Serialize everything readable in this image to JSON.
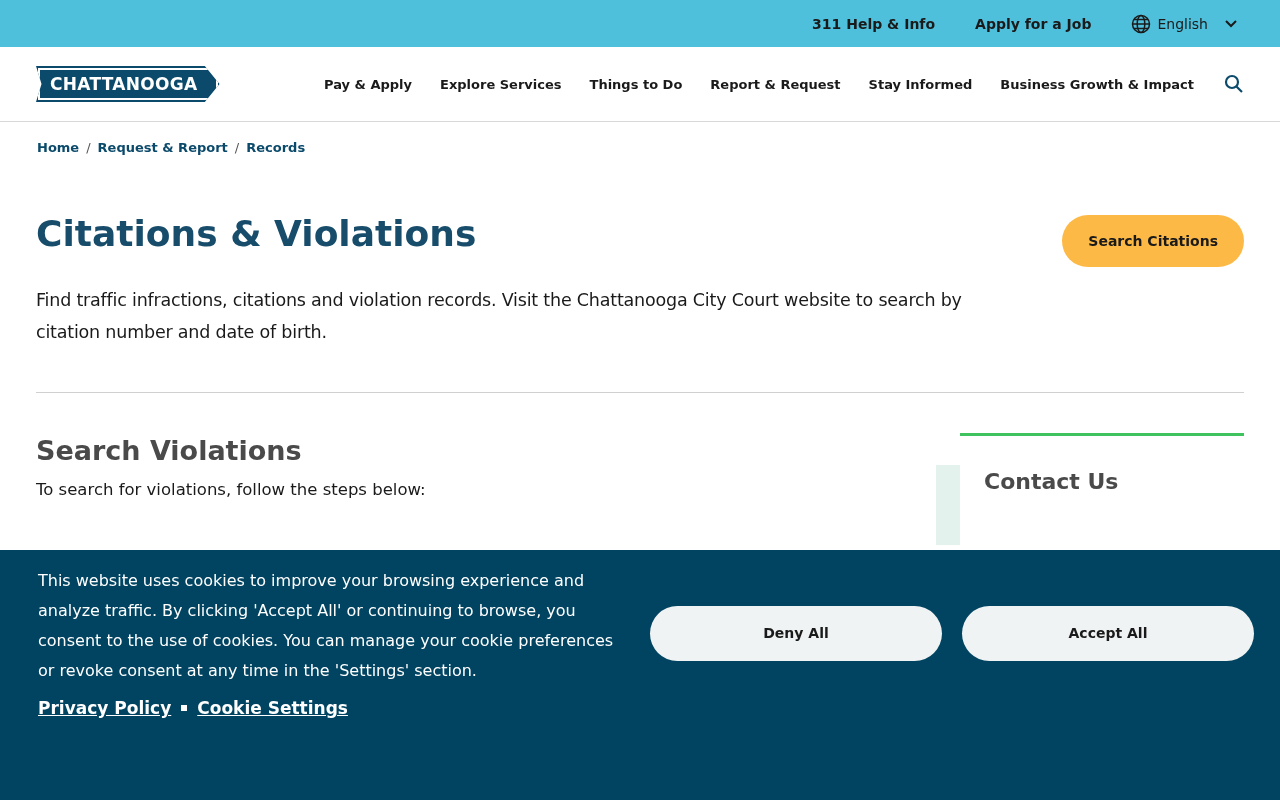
{
  "utility_bar": {
    "links": [
      "311 Help & Info",
      "Apply for a Job"
    ],
    "language": "English"
  },
  "header": {
    "logo": "CHATTANOOGA",
    "nav": [
      "Pay & Apply",
      "Explore Services",
      "Things to Do",
      "Report & Request",
      "Stay Informed",
      "Business Growth & Impact"
    ]
  },
  "breadcrumb": {
    "separator": "/",
    "items": [
      "Home",
      "Request & Report",
      "Records"
    ]
  },
  "page": {
    "title": "Citations & Violations",
    "action": "Search Citations",
    "intro": "Find traffic infractions, citations and violation records. Visit the Chattanooga City Court website to search by citation number and date of birth."
  },
  "section": {
    "title": "Search Violations",
    "lead": "To search for violations, follow the steps below:"
  },
  "sidebar": {
    "title": "Contact Us"
  },
  "cookie_banner": {
    "message": "This website uses cookies to improve your browsing experience and analyze traffic. By clicking 'Accept All' or continuing to browse, you consent to the use of cookies. You can manage your cookie preferences or revoke consent at any time in the 'Settings' section.",
    "links": [
      "Privacy Policy",
      "Cookie Settings"
    ],
    "buttons": [
      "Deny All",
      "Accept All"
    ]
  }
}
